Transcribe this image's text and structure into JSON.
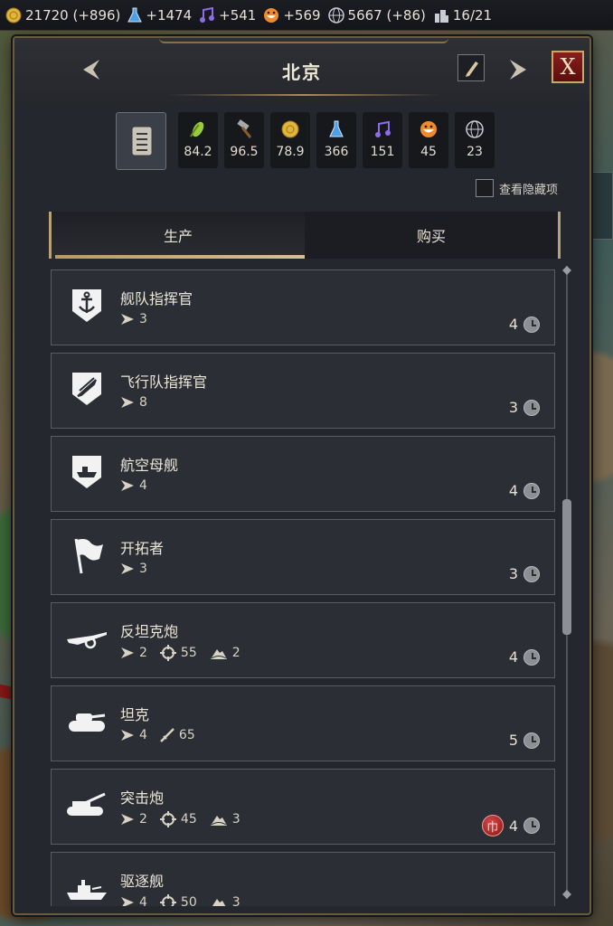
{
  "topbar": {
    "gold": "21720 (+896)",
    "science": "+1474",
    "culture": "+541",
    "faith": "+569",
    "tourism": "5667 (+86)",
    "trade": "16/21"
  },
  "city": {
    "name": "北京",
    "close_label": "X"
  },
  "yields": [
    {
      "icon": "food-icon",
      "value": "84.2"
    },
    {
      "icon": "production-icon",
      "value": "96.5"
    },
    {
      "icon": "gold-icon",
      "value": "78.9"
    },
    {
      "icon": "science-icon",
      "value": "366"
    },
    {
      "icon": "culture-icon",
      "value": "151"
    },
    {
      "icon": "faith-icon",
      "value": "45"
    },
    {
      "icon": "tourism-icon",
      "value": "23"
    }
  ],
  "hidden_toggle": {
    "label": "查看隐藏项",
    "checked": false
  },
  "tabs": [
    {
      "label": "生产",
      "active": true
    },
    {
      "label": "购买",
      "active": false
    }
  ],
  "units": [
    {
      "name": "舰队指挥官",
      "icon": "anchor-shield-icon",
      "move": "3",
      "turns": "4"
    },
    {
      "name": "飞行队指挥官",
      "icon": "wing-shield-icon",
      "move": "8",
      "turns": "3"
    },
    {
      "name": "航空母舰",
      "icon": "carrier-shield-icon",
      "move": "4",
      "turns": "4"
    },
    {
      "name": "开拓者",
      "icon": "flag-icon",
      "move": "3",
      "turns": "3"
    },
    {
      "name": "反坦克炮",
      "icon": "antitank-gun-icon",
      "move": "2",
      "ranged": "55",
      "range": "2",
      "turns": "4"
    },
    {
      "name": "坦克",
      "icon": "tank-icon",
      "move": "4",
      "melee": "65",
      "turns": "5"
    },
    {
      "name": "突击炮",
      "icon": "assault-gun-icon",
      "move": "2",
      "ranged": "45",
      "range": "3",
      "turns": "4",
      "badge": "巾"
    },
    {
      "name": "驱逐舰",
      "icon": "destroyer-icon",
      "move": "4",
      "ranged": "50",
      "range": "3"
    }
  ],
  "colors": {
    "panel_bg": "#24272d",
    "accent_gold": "#b89a64",
    "close_red": "#8a1e1e"
  }
}
